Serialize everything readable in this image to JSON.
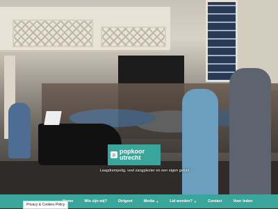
{
  "brand": {
    "logo_line1": "popkoor",
    "logo_line2": "utrecht",
    "badge_letter": "p",
    "accent_color": "#3aa59a"
  },
  "hero": {
    "tagline": "Laagdrempelig, veel zangplezier en een eigen geluid"
  },
  "nav": {
    "items": [
      {
        "label": "Home",
        "has_dropdown": false
      },
      {
        "label": "Wie zijn wij?",
        "has_dropdown": false
      },
      {
        "label": "Dirigent",
        "has_dropdown": false
      },
      {
        "label": "Media",
        "has_dropdown": true
      },
      {
        "label": "Lid worden?",
        "has_dropdown": true
      },
      {
        "label": "Contact",
        "has_dropdown": false
      },
      {
        "label": "Voor leden",
        "has_dropdown": false
      }
    ]
  },
  "footer": {
    "privacy_label": "Privacy & Cookies Policy"
  }
}
